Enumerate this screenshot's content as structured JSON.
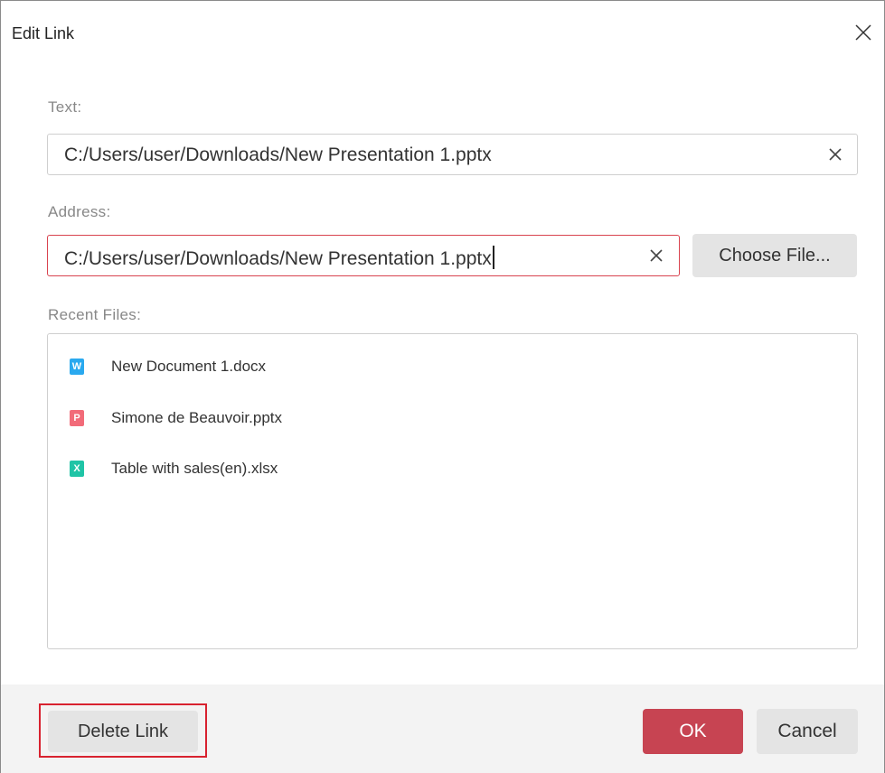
{
  "dialog": {
    "title": "Edit Link"
  },
  "text_field": {
    "label": "Text:",
    "value": "C:/Users/user/Downloads/New Presentation 1.pptx"
  },
  "address_field": {
    "label": "Address:",
    "value": "C:/Users/user/Downloads/New Presentation 1.pptx",
    "choose_label": "Choose File..."
  },
  "recent": {
    "label": "Recent Files:",
    "items": [
      {
        "name": "New Document 1.docx",
        "icon": "word-doc-icon",
        "letter": "W",
        "color": "#2aa9ef"
      },
      {
        "name": "Simone de Beauvoir.pptx",
        "icon": "powerpoint-doc-icon",
        "letter": "P",
        "color": "#f26b79"
      },
      {
        "name": "Table with sales(en).xlsx",
        "icon": "excel-doc-icon",
        "letter": "X",
        "color": "#1fc4a6"
      }
    ]
  },
  "footer": {
    "delete_label": "Delete Link",
    "ok_label": "OK",
    "cancel_label": "Cancel"
  },
  "colors": {
    "accent": "#c74452",
    "error_border": "#d9434f",
    "highlight": "#d8222f"
  }
}
